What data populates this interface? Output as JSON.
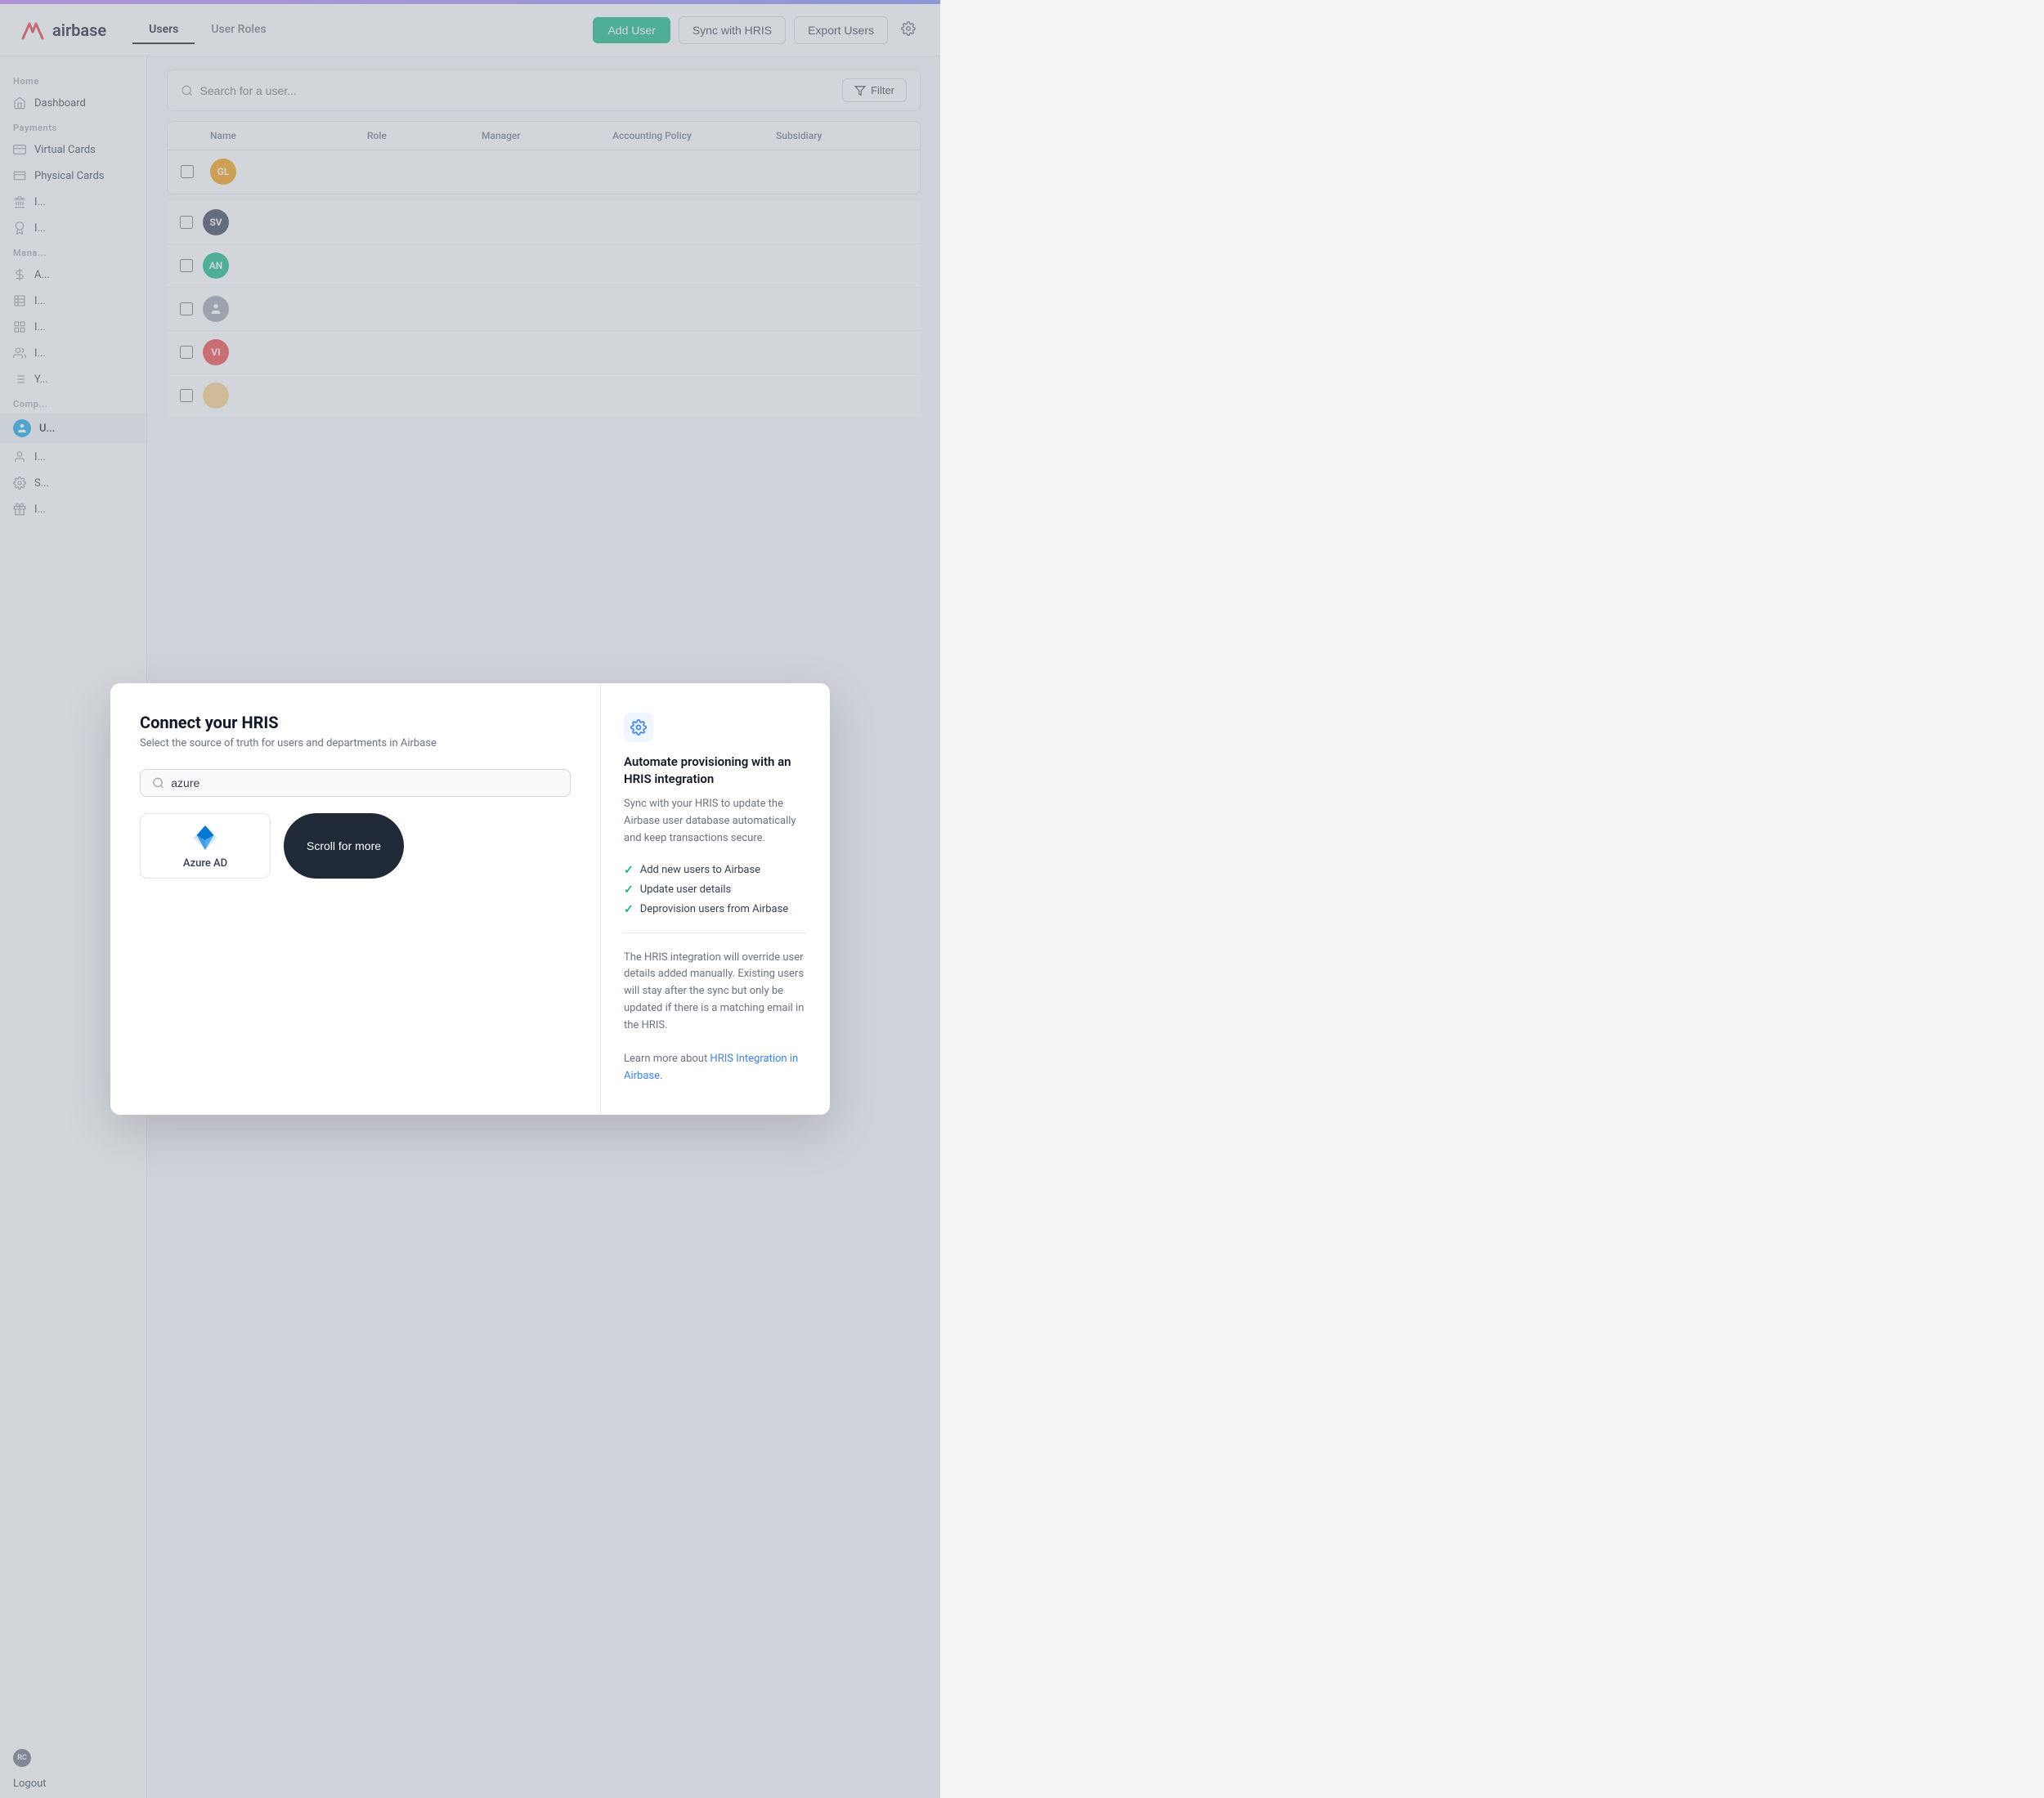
{
  "app": {
    "name": "airbase",
    "accent_bar": true
  },
  "header": {
    "tabs": [
      {
        "id": "users",
        "label": "Users",
        "active": true
      },
      {
        "id": "user-roles",
        "label": "User Roles",
        "active": false
      }
    ],
    "actions": {
      "add_user": "Add User",
      "sync_hris": "Sync with HRIS",
      "export_users": "Export Users"
    }
  },
  "sidebar": {
    "sections": [
      {
        "label": "Home",
        "items": [
          {
            "id": "dashboard",
            "label": "Dashboard",
            "icon": "home-icon"
          }
        ]
      },
      {
        "label": "Payments",
        "items": [
          {
            "id": "virtual-cards",
            "label": "Virtual Cards",
            "icon": "card-icon"
          },
          {
            "id": "physical-cards",
            "label": "Physical Cards",
            "icon": "card-flat-icon"
          },
          {
            "id": "item3",
            "label": "I...",
            "icon": "bank-icon"
          },
          {
            "id": "item4",
            "label": "I...",
            "icon": "badge-icon"
          }
        ]
      },
      {
        "label": "Mana...",
        "items": [
          {
            "id": "item5",
            "label": "A...",
            "icon": "dollar-icon"
          },
          {
            "id": "item6",
            "label": "I...",
            "icon": "table-icon"
          },
          {
            "id": "item7",
            "label": "I...",
            "icon": "grid-icon"
          },
          {
            "id": "item8",
            "label": "I...",
            "icon": "people-icon"
          },
          {
            "id": "item9",
            "label": "Y...",
            "icon": "list-icon"
          }
        ]
      },
      {
        "label": "Comp...",
        "items": [
          {
            "id": "users-active",
            "label": "U...",
            "icon": "user-circle-icon",
            "avatar_color": "#0ea5e9",
            "active": true
          },
          {
            "id": "item11",
            "label": "I...",
            "icon": "user-icon"
          }
        ]
      },
      {
        "items": [
          {
            "id": "settings",
            "label": "S...",
            "icon": "gear-icon"
          },
          {
            "id": "item13",
            "label": "I...",
            "icon": "gift-icon"
          }
        ]
      }
    ],
    "bottom": {
      "avatar_initials": "RC",
      "avatar_color": "#6b7280",
      "logout_label": "Logout"
    }
  },
  "table": {
    "search_placeholder": "Search for a user...",
    "filter_label": "Filter",
    "columns": [
      "",
      "Name",
      "Role",
      "Manager",
      "Accounting Policy",
      "Subsidiary"
    ],
    "rows": [
      {
        "initials": "GL",
        "color": "#f59e0b"
      },
      {
        "initials": "SV",
        "color": "#374151"
      },
      {
        "initials": "AN",
        "color": "#10b981"
      },
      {
        "initials": "",
        "color": "#9ca3af",
        "empty": true
      },
      {
        "initials": "VI",
        "color": "#ef4444"
      },
      {
        "initials": "",
        "color": "#f59e0b",
        "partial": true
      }
    ]
  },
  "modal": {
    "title": "Connect your HRIS",
    "subtitle": "Select the source of truth for users and departments in Airbase",
    "search_placeholder": "azure",
    "integrations": [
      {
        "id": "azure-ad",
        "label": "Azure AD",
        "icon": "azure-icon"
      }
    ],
    "scroll_for_more": "Scroll for more",
    "right_panel": {
      "icon": "gear-blue-icon",
      "title": "Automate provisioning with an HRIS integration",
      "description": "Sync with your HRIS to update the Airbase user database automatically and keep transactions secure.",
      "checklist": [
        "Add new users to Airbase",
        "Update user details",
        "Deprovision users from Airbase"
      ],
      "footer_text": "The HRIS integration will override user details added manually. Existing users will stay after the sync but only be updated if there is a matching email in the HRIS.",
      "link_label": "HRIS Integration in Airbase.",
      "link_prefix": "Learn more about "
    }
  }
}
